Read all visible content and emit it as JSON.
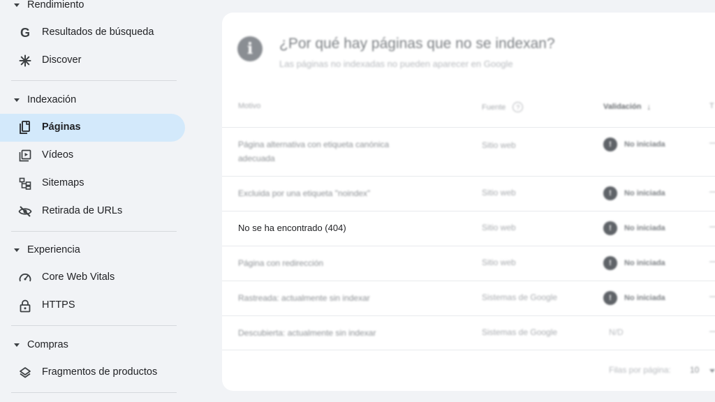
{
  "sidebar": {
    "sections": [
      {
        "title": "Rendimiento",
        "items": [
          {
            "label": "Resultados de búsqueda",
            "icon": "google-g-icon"
          },
          {
            "label": "Discover",
            "icon": "asterisk-icon"
          }
        ]
      },
      {
        "title": "Indexación",
        "items": [
          {
            "label": "Páginas",
            "icon": "pages-icon",
            "active": true
          },
          {
            "label": "Vídeos",
            "icon": "video-icon"
          },
          {
            "label": "Sitemaps",
            "icon": "sitemap-icon"
          },
          {
            "label": "Retirada de URLs",
            "icon": "eye-off-icon"
          }
        ]
      },
      {
        "title": "Experiencia",
        "items": [
          {
            "label": "Core Web Vitals",
            "icon": "gauge-icon"
          },
          {
            "label": "HTTPS",
            "icon": "lock-icon"
          }
        ]
      },
      {
        "title": "Compras",
        "items": [
          {
            "label": "Fragmentos de productos",
            "icon": "layers-icon"
          }
        ]
      }
    ]
  },
  "card": {
    "info_icon": "i",
    "title": "¿Por qué hay páginas que no se indexan?",
    "subtitle": "Las páginas no indexadas no pueden aparecer en Google",
    "columns": {
      "reason": "Motivo",
      "source": "Fuente",
      "validation": "Validación",
      "trend": "T"
    },
    "rows": [
      {
        "reason": "Página alternativa con etiqueta canónica adecuada",
        "source": "Sitio web",
        "validation": "No iniciada",
        "trend": "—"
      },
      {
        "reason": "Excluida por una etiqueta \"noindex\"",
        "source": "Sitio web",
        "validation": "No iniciada",
        "trend": "—"
      },
      {
        "reason": "No se ha encontrado (404)",
        "source": "Sitio web",
        "validation": "No iniciada",
        "trend": "—"
      },
      {
        "reason": "Página con redirección",
        "source": "Sitio web",
        "validation": "No iniciada",
        "trend": "—"
      },
      {
        "reason": "Rastreada: actualmente sin indexar",
        "source": "Sistemas de Google",
        "validation": "No iniciada",
        "trend": "—"
      },
      {
        "reason": "Descubierta: actualmente sin indexar",
        "source": "Sistemas de Google",
        "validation": "N/D",
        "trend": "—"
      }
    ],
    "footer": {
      "rows_per_page_label": "Filas por página:",
      "rows_per_page_value": "10"
    }
  }
}
